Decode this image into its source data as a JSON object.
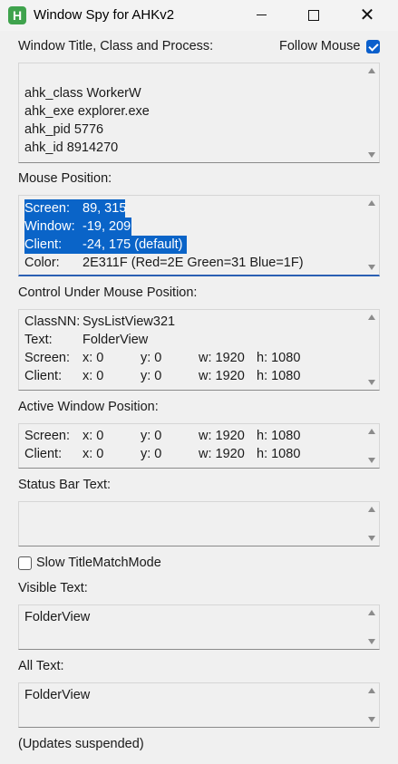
{
  "window": {
    "title": "Window Spy for AHKv2",
    "icon_letter": "H",
    "min_glyph": "—",
    "max_glyph": "☐",
    "close_glyph": "✕"
  },
  "window_title_section": {
    "label": "Window Title, Class and Process:",
    "follow_mouse_label": "Follow Mouse",
    "follow_mouse_checked": true,
    "lines": [
      "ahk_class WorkerW",
      "ahk_exe explorer.exe",
      "ahk_pid 5776",
      "ahk_id 8914270"
    ]
  },
  "mouse_position": {
    "label": "Mouse Position:",
    "rows": [
      {
        "key": "Screen:",
        "value": "89, 315"
      },
      {
        "key": "Window:",
        "value": "-19, 209"
      },
      {
        "key": "Client:",
        "value": "-24, 175 (default)"
      },
      {
        "key": "Color:",
        "value": "2E311F (Red=2E Green=31 Blue=1F)"
      }
    ]
  },
  "control_under_mouse": {
    "label": "Control Under Mouse Position:",
    "classnn_key": "ClassNN:",
    "classnn_value": "SysListView321",
    "text_key": "Text:",
    "text_value": "FolderView",
    "rows": [
      {
        "key": "Screen:",
        "x": "x: 0",
        "y": "y: 0",
        "w": "w: 1920",
        "h": "h: 1080"
      },
      {
        "key": "Client:",
        "x": "x: 0",
        "y": "y: 0",
        "w": "w: 1920",
        "h": "h: 1080"
      }
    ]
  },
  "active_window": {
    "label": "Active Window Position:",
    "rows": [
      {
        "key": "Screen:",
        "x": "x: 0",
        "y": "y: 0",
        "w": "w: 1920",
        "h": "h: 1080"
      },
      {
        "key": "Client:",
        "x": "x: 0",
        "y": "y: 0",
        "w": "w: 1920",
        "h": "h: 1080"
      }
    ]
  },
  "status_bar": {
    "label": "Status Bar Text:",
    "text": ""
  },
  "slow_title": {
    "label": "Slow TitleMatchMode",
    "checked": false
  },
  "visible_text": {
    "label": "Visible Text:",
    "text": "FolderView"
  },
  "all_text": {
    "label": "All Text:",
    "text": "FolderView"
  },
  "footer": {
    "status": "(Updates suspended)"
  },
  "colors": {
    "accent": "#0a5fcc",
    "selection": "#0a64c8",
    "icon_green": "#3fa34d"
  }
}
